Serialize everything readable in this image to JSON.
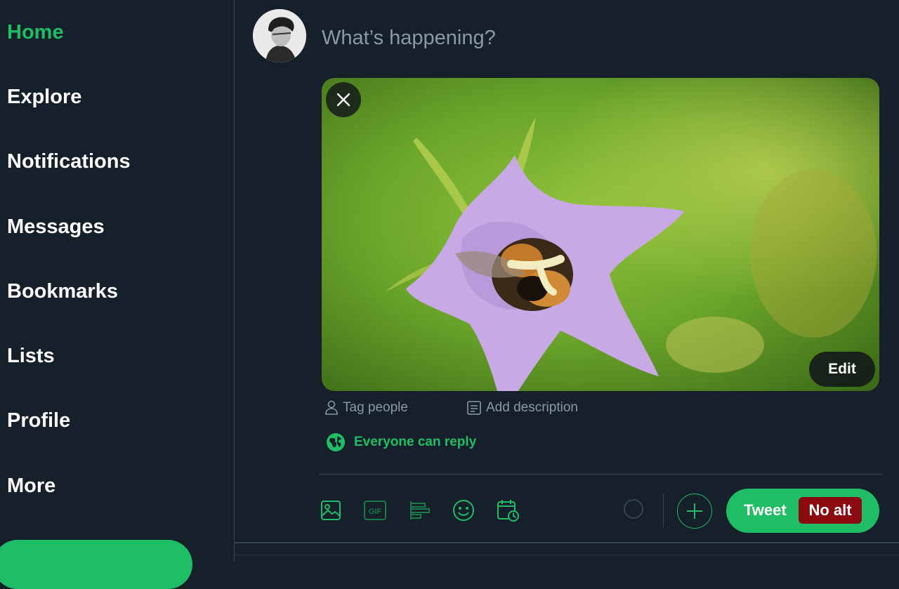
{
  "sidebar": {
    "items": [
      {
        "label": "Home",
        "active": true
      },
      {
        "label": "Explore"
      },
      {
        "label": "Notifications"
      },
      {
        "label": "Messages"
      },
      {
        "label": "Bookmarks"
      },
      {
        "label": "Lists"
      },
      {
        "label": "Profile"
      },
      {
        "label": "More"
      }
    ]
  },
  "composer": {
    "placeholder": "What’s happening?",
    "media": {
      "edit_label": "Edit",
      "close_icon": "close-icon"
    },
    "tag_people": "Tag people",
    "add_description": "Add description",
    "reply_setting": "Everyone can reply"
  },
  "toolbar": {
    "icons": [
      "image-icon",
      "gif-icon",
      "poll-icon",
      "emoji-icon",
      "schedule-icon"
    ],
    "tweet_label": "Tweet",
    "no_alt_badge": "No alt"
  },
  "colors": {
    "accent": "#1fbe66",
    "background": "#15202b",
    "muted_text": "#8b98a5",
    "badge_red": "#8a0a10"
  }
}
